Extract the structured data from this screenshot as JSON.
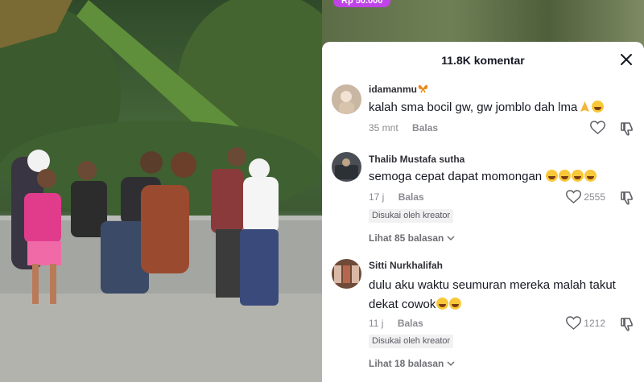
{
  "video": {
    "gift_badge": "Rp 50.000"
  },
  "sheet": {
    "title": "11.8K komentar",
    "close_icon": "close-icon"
  },
  "comments": [
    {
      "username": "idamanmu",
      "username_icon": "butterfly-icon",
      "text": "kalah sma bocil gw, gw jomblo dah lma",
      "emojis": [
        "folded-hands",
        "smiling-face"
      ],
      "time": "35 mnt",
      "reply_label": "Balas",
      "likes": ""
    },
    {
      "username": "Thalib Mustafa sutha",
      "text": "semoga cepat dapat momongan",
      "emojis": [
        "laughing-face",
        "laughing-face",
        "rolling-laughing-face",
        "rolling-laughing-face"
      ],
      "time": "17 j",
      "reply_label": "Balas",
      "likes": "2555",
      "creator_badge": "Disukai oleh kreator",
      "view_replies": "Lihat 85 balasan"
    },
    {
      "username": "Sitti Nurkhalifah",
      "text": "dulu aku waktu seumuran mereka malah takut dekat cowok",
      "emojis": [
        "laughing-face",
        "laughing-face"
      ],
      "time": "11 j",
      "reply_label": "Balas",
      "likes": "1212",
      "creator_badge": "Disukai oleh kreator",
      "view_replies": "Lihat 18 balasan"
    }
  ],
  "colors": {
    "accent_badge": "#c043e8",
    "text_primary": "#161823",
    "text_secondary": "#8a8b91"
  }
}
